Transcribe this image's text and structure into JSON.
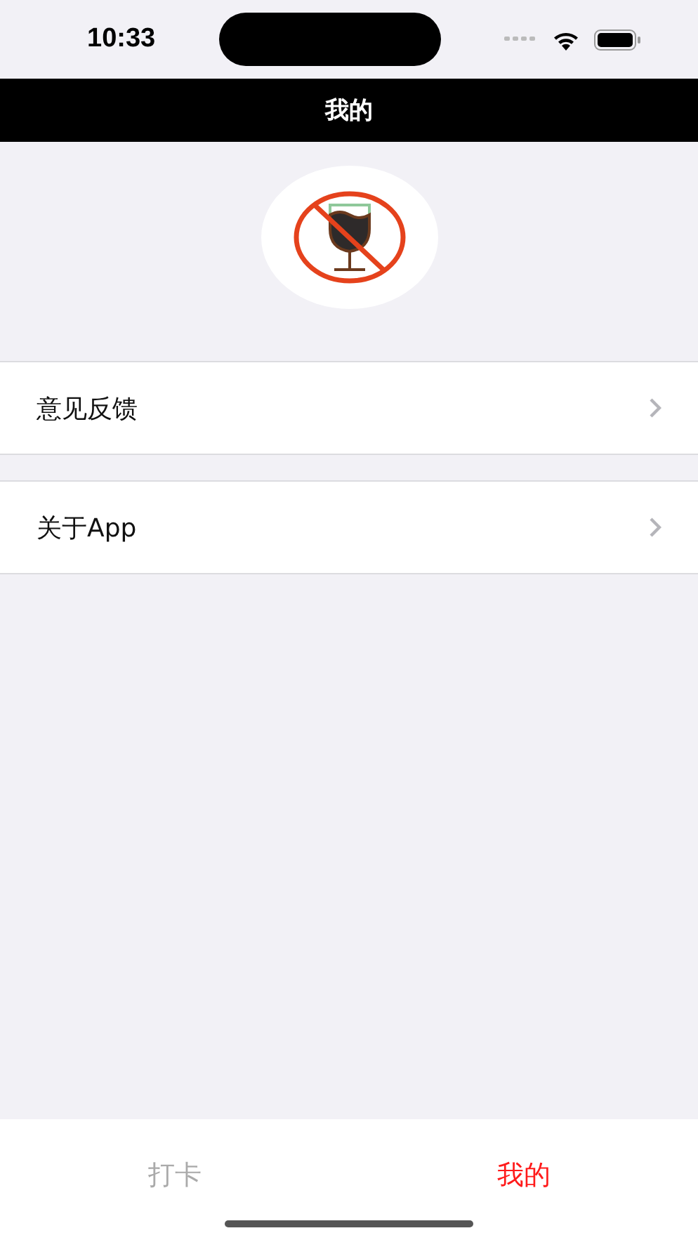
{
  "status_bar": {
    "time": "10:33"
  },
  "nav_bar": {
    "title": "我的"
  },
  "menu_items": [
    {
      "label": "意见反馈"
    },
    {
      "label": "关于App"
    }
  ],
  "tabs": [
    {
      "label": "打卡",
      "selected": false
    },
    {
      "label": "我的",
      "selected": true
    }
  ]
}
